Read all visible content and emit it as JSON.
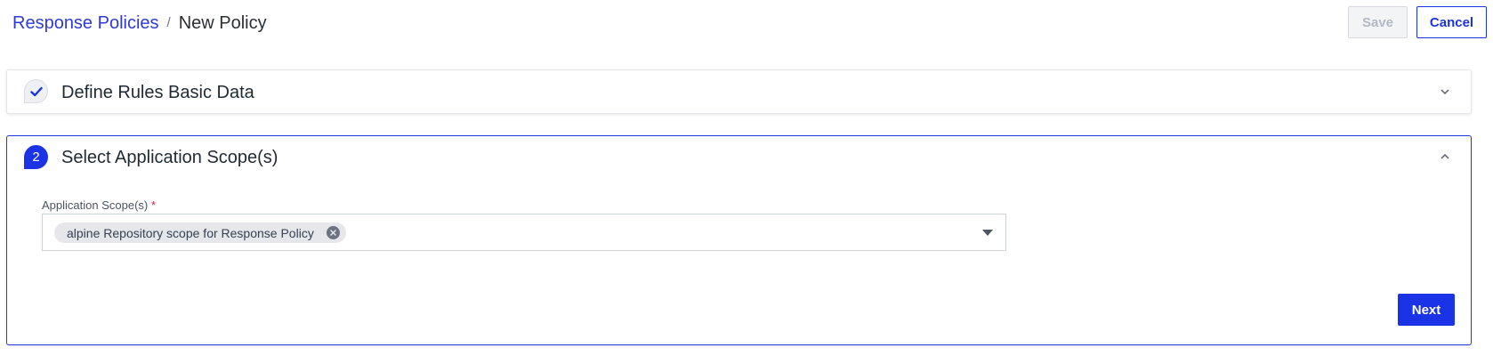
{
  "breadcrumb": {
    "parent": "Response Policies",
    "separator": "/",
    "current": "New Policy"
  },
  "actions": {
    "save_label": "Save",
    "save_disabled": true,
    "cancel_label": "Cancel"
  },
  "steps": [
    {
      "status": "completed",
      "icon": "check-icon",
      "title": "Define Rules Basic Data",
      "expanded": false
    },
    {
      "number": "2",
      "status": "active",
      "title": "Select Application Scope(s)",
      "expanded": true,
      "field": {
        "label": "Application Scope(s)",
        "required_marker": "*",
        "selected_chips": [
          "alpine Repository scope for Response Policy"
        ]
      },
      "next_label": "Next"
    }
  ],
  "colors": {
    "primary": "#1b33e6",
    "link": "#2d3bd4",
    "required": "#e11d48"
  }
}
